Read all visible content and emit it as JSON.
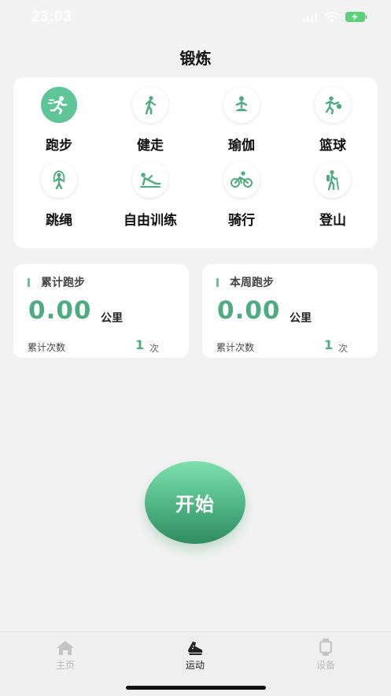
{
  "status_bar": {
    "time": "23:03"
  },
  "header": {
    "title": "锻炼"
  },
  "sports": [
    {
      "label": "跑步",
      "icon": "running-icon",
      "active": true
    },
    {
      "label": "健走",
      "icon": "walking-icon",
      "active": false
    },
    {
      "label": "瑜伽",
      "icon": "yoga-icon",
      "active": false
    },
    {
      "label": "篮球",
      "icon": "basketball-icon",
      "active": false
    },
    {
      "label": "跳绳",
      "icon": "jump-rope-icon",
      "active": false
    },
    {
      "label": "自由训练",
      "icon": "free-training-icon",
      "active": false
    },
    {
      "label": "骑行",
      "icon": "cycling-icon",
      "active": false
    },
    {
      "label": "登山",
      "icon": "hiking-icon",
      "active": false
    }
  ],
  "stats": [
    {
      "title": "累计跑步",
      "value": "0.00",
      "unit": "公里",
      "count_label": "累计次数",
      "count": "1",
      "count_unit": "次"
    },
    {
      "title": "本周跑步",
      "value": "0.00",
      "unit": "公里",
      "count_label": "累计次数",
      "count": "1",
      "count_unit": "次"
    }
  ],
  "start_button": {
    "label": "开始"
  },
  "tab_bar": {
    "tabs": [
      {
        "label": "主页",
        "icon": "home-icon",
        "active": false
      },
      {
        "label": "运动",
        "icon": "sneaker-icon",
        "active": true
      },
      {
        "label": "设备",
        "icon": "watch-icon",
        "active": false
      }
    ]
  },
  "colors": {
    "accent": "#5fc497",
    "accent_dark": "#4fab80",
    "background": "#f2f2f2"
  }
}
